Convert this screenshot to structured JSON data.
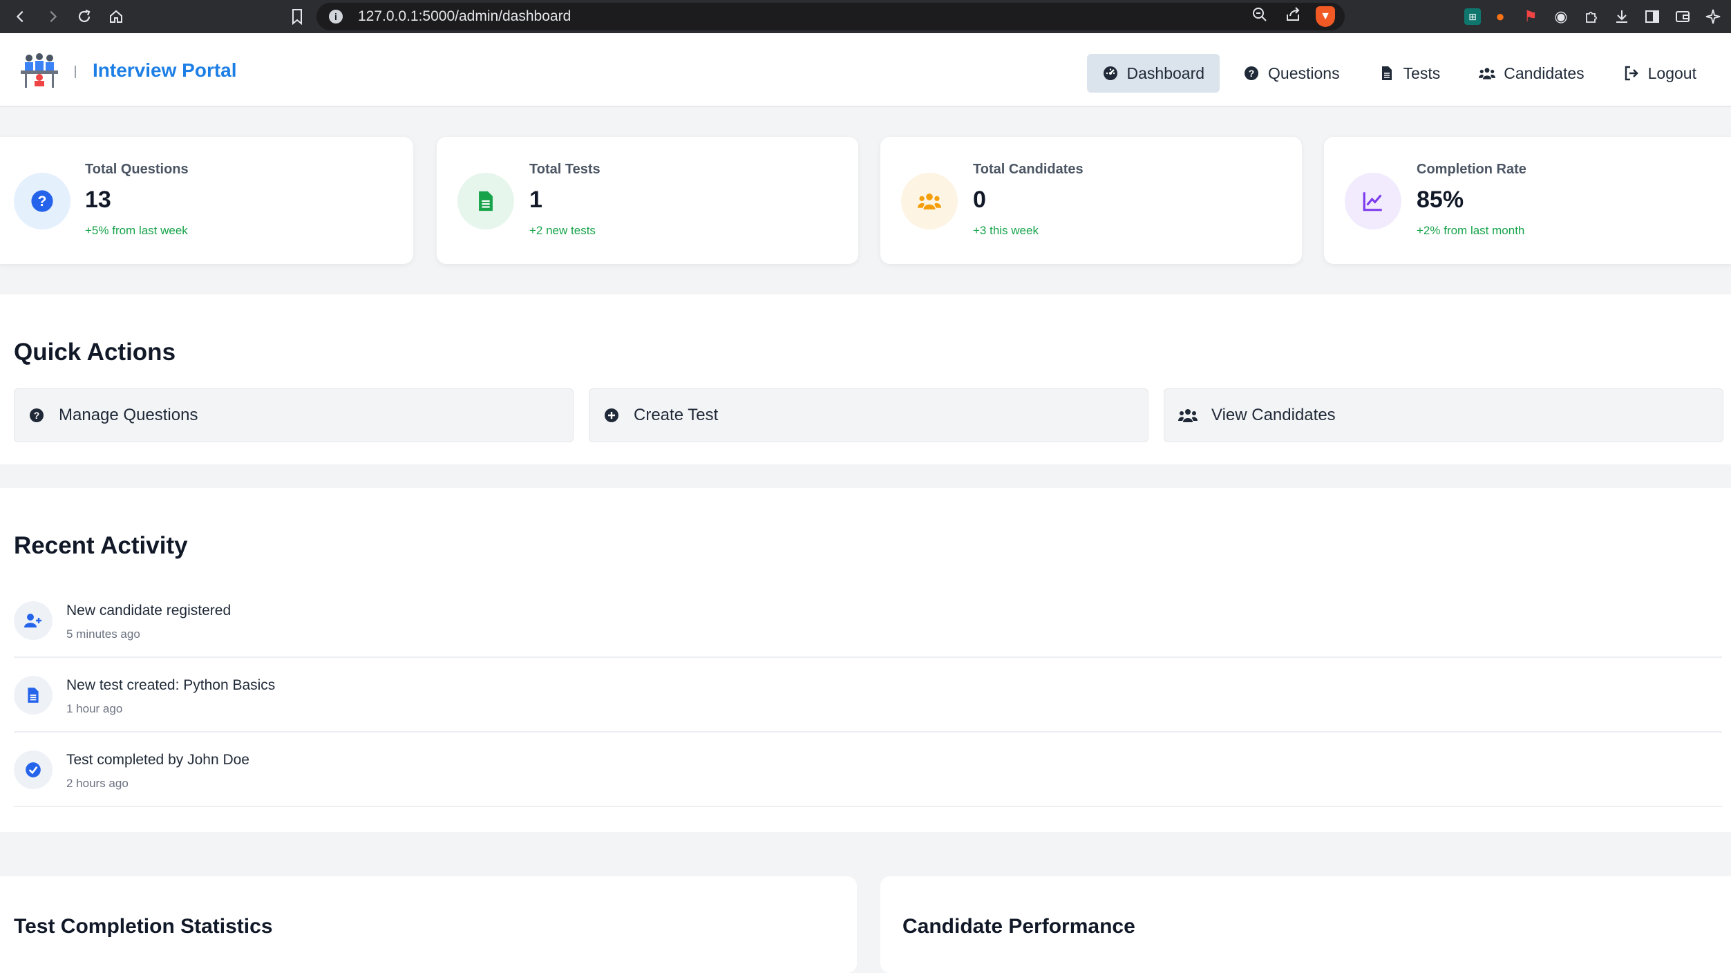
{
  "browser": {
    "url": "127.0.0.1:5000/admin/dashboard"
  },
  "app": {
    "brand": "Interview Portal",
    "nav": [
      {
        "label": "Dashboard",
        "icon": "dashboard-icon",
        "active": true
      },
      {
        "label": "Questions",
        "icon": "question-circle-icon"
      },
      {
        "label": "Tests",
        "icon": "file-icon"
      },
      {
        "label": "Candidates",
        "icon": "users-icon"
      },
      {
        "label": "Logout",
        "icon": "logout-icon"
      }
    ]
  },
  "stats": [
    {
      "label": "Total Questions",
      "value": "13",
      "change": "+5% from last week",
      "icon": "question-circle-icon",
      "color": "#2563eb",
      "bg": "#e5f0fd"
    },
    {
      "label": "Total Tests",
      "value": "1",
      "change": "+2 new tests",
      "icon": "file-icon",
      "color": "#16a34a",
      "bg": "#e7f6ec"
    },
    {
      "label": "Total Candidates",
      "value": "0",
      "change": "+3 this week",
      "icon": "users-icon",
      "color": "#f59e0b",
      "bg": "#fdf4e3"
    },
    {
      "label": "Completion Rate",
      "value": "85%",
      "change": "+2% from last month",
      "icon": "line-chart-icon",
      "color": "#7c3aed",
      "bg": "#f1ebfd"
    }
  ],
  "quick_actions": {
    "title": "Quick Actions",
    "items": [
      {
        "label": "Manage Questions",
        "icon": "question-circle-icon"
      },
      {
        "label": "Create Test",
        "icon": "plus-circle-icon"
      },
      {
        "label": "View Candidates",
        "icon": "users-icon"
      }
    ]
  },
  "recent_activity": {
    "title": "Recent Activity",
    "items": [
      {
        "title": "New candidate registered",
        "time": "5 minutes ago",
        "icon": "user-plus-icon"
      },
      {
        "title": "New test created: Python Basics",
        "time": "1 hour ago",
        "icon": "file-icon"
      },
      {
        "title": "Test completed by John Doe",
        "time": "2 hours ago",
        "icon": "check-circle-icon"
      }
    ]
  },
  "panels": [
    {
      "title": "Test Completion Statistics"
    },
    {
      "title": "Candidate Performance"
    }
  ]
}
